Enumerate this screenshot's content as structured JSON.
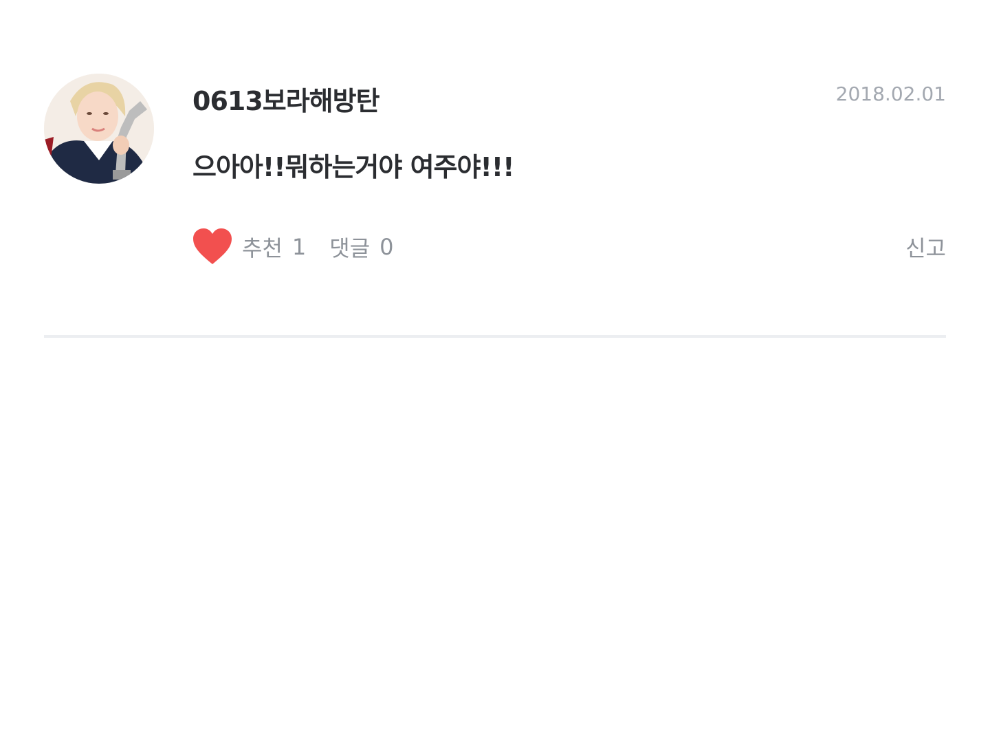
{
  "comment": {
    "author": "0613보라해방탄",
    "date": "2018.02.01",
    "text": "으아아!!뭐하는거야 여주야!!!",
    "avatar_icon": "user-avatar-photo",
    "like": {
      "icon": "heart-icon",
      "icon_color": "#f2504f",
      "label": "추천",
      "count": "1"
    },
    "reply": {
      "label": "댓글",
      "count": "0"
    },
    "report_label": "신고"
  },
  "colors": {
    "text_primary": "#2b2d31",
    "text_secondary": "#8d9299",
    "date_text": "#a3a8b0",
    "divider": "#eceef1"
  }
}
